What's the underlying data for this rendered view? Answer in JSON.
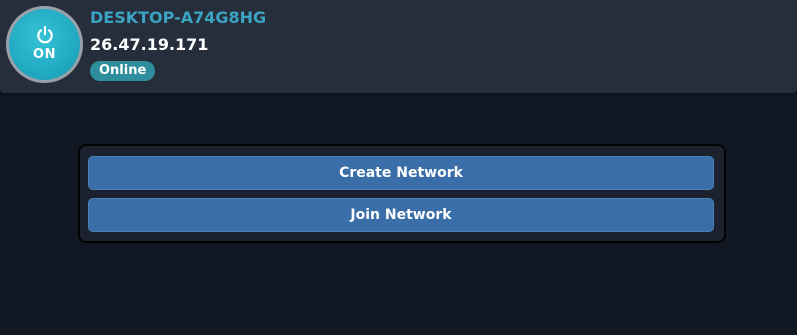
{
  "header": {
    "power_button": {
      "label": "ON",
      "icon": "power-icon",
      "color": "#22aac3"
    },
    "host_name": "DESKTOP-A74G8HG",
    "ip_address": "26.47.19.171",
    "status": {
      "label": "Online",
      "color": "#2e8e9d"
    }
  },
  "actions": {
    "create_label": "Create Network",
    "join_label": "Join Network",
    "button_color": "#3a6ea8"
  },
  "colors": {
    "background": "#111723",
    "header": "#262e3c",
    "host_name": "#3aa4c2"
  }
}
